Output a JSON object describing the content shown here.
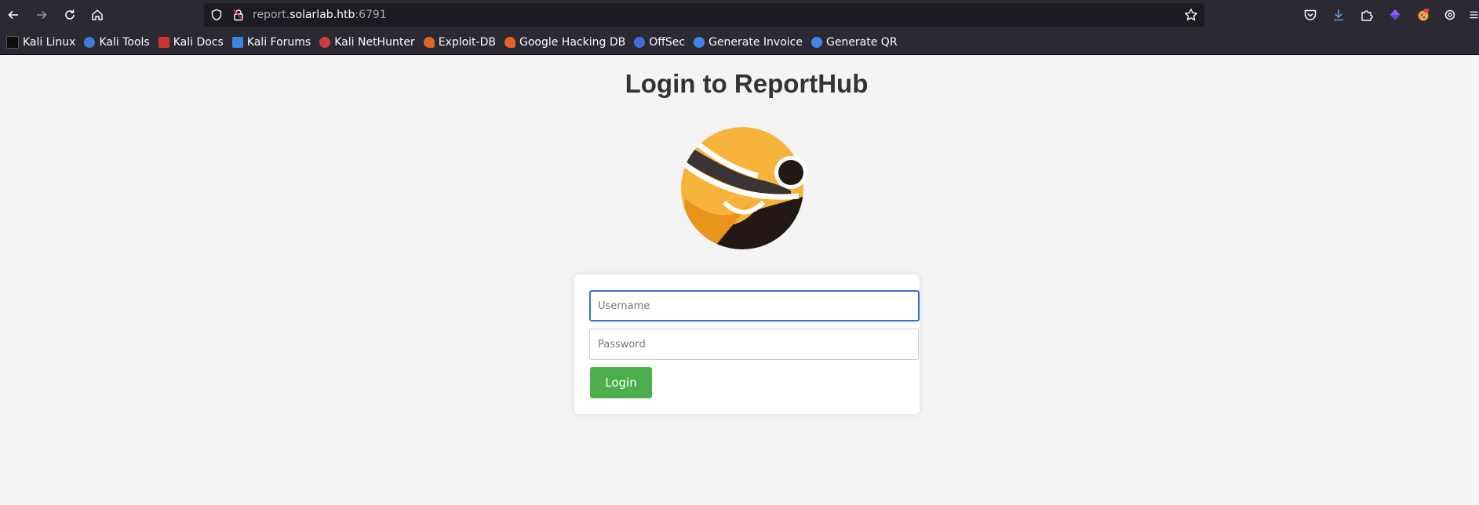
{
  "browser": {
    "url": {
      "subdomain": "report.",
      "domain": "solarlab.htb",
      "port": ":6791"
    },
    "icons": {
      "back": "back-arrow-icon",
      "forward": "forward-arrow-icon",
      "reload": "reload-icon",
      "home": "home-icon",
      "tracking_protection": "shield-icon",
      "connection": "insecure-lock-icon",
      "bookmark_star": "star-icon",
      "pocket": "pocket-icon",
      "downloads": "download-icon",
      "extensions": "puzzle-icon",
      "menu": "hamburger-menu-icon"
    },
    "bookmarks": [
      {
        "label": "Kali Linux",
        "icon": "kali-dragon-icon",
        "color": "#111111"
      },
      {
        "label": "Kali Tools",
        "icon": "kali-tools-icon",
        "color": "#3f7ad8"
      },
      {
        "label": "Kali Docs",
        "icon": "kali-docs-icon",
        "color": "#d1342f"
      },
      {
        "label": "Kali Forums",
        "icon": "kali-forums-icon",
        "color": "#3b84d9"
      },
      {
        "label": "Kali NetHunter",
        "icon": "nethunter-icon",
        "color": "#d43b3b"
      },
      {
        "label": "Exploit-DB",
        "icon": "exploit-db-icon",
        "color": "#e0642a"
      },
      {
        "label": "Google Hacking DB",
        "icon": "ghdb-icon",
        "color": "#e0642a"
      },
      {
        "label": "OffSec",
        "icon": "offsec-icon",
        "color": "#3d6fe0"
      },
      {
        "label": "Generate Invoice",
        "icon": "globe-icon",
        "color": "#3f86e6"
      },
      {
        "label": "Generate QR",
        "icon": "globe-icon",
        "color": "#3f86e6"
      }
    ]
  },
  "page": {
    "title": "Login to ReportHub",
    "logo": "reporthub-logo",
    "form": {
      "username_placeholder": "Username",
      "password_placeholder": "Password",
      "login_label": "Login"
    },
    "colors": {
      "background": "#f4f4f4",
      "button": "#4cae4c",
      "focus_border": "#2f74d0",
      "logo_orange": "#f7b33b",
      "logo_dark": "#231815"
    }
  }
}
